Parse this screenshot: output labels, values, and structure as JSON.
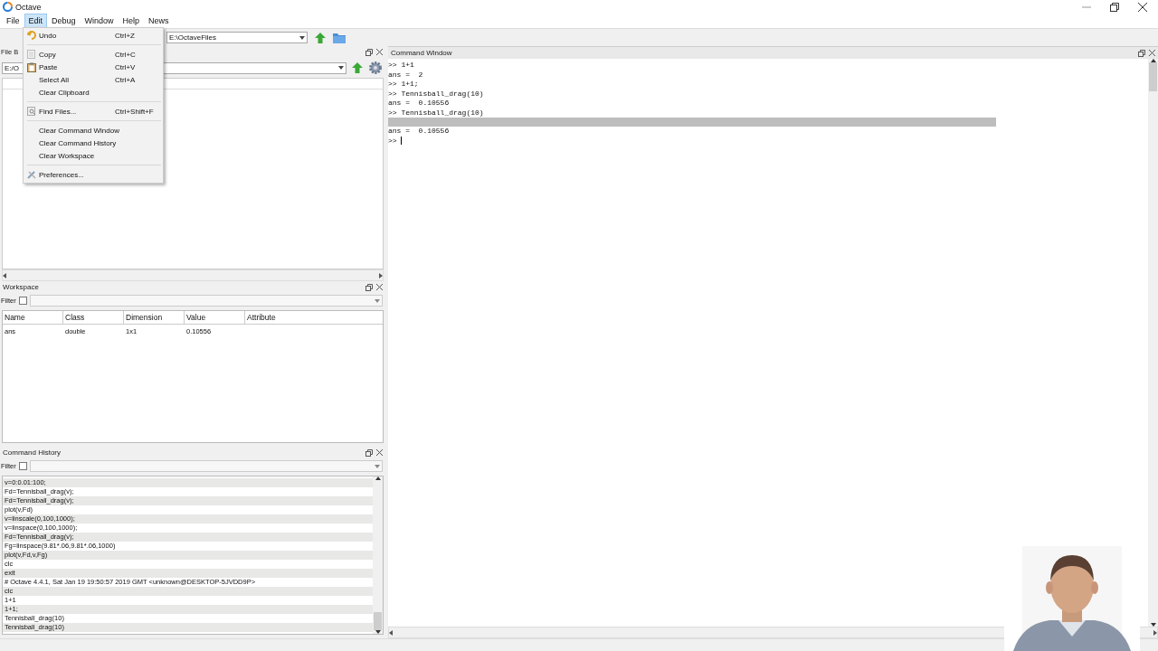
{
  "window": {
    "title": "Octave"
  },
  "menu_bar": [
    {
      "label": "File",
      "selected": false
    },
    {
      "label": "Edit",
      "selected": true
    },
    {
      "label": "Debug",
      "selected": false
    },
    {
      "label": "Window",
      "selected": false
    },
    {
      "label": "Help",
      "selected": false
    },
    {
      "label": "News",
      "selected": false
    }
  ],
  "edit_menu": {
    "groups": [
      [
        {
          "label": "Undo",
          "shortcut": "Ctrl+Z"
        }
      ],
      [
        {
          "label": "Copy",
          "shortcut": "Ctrl+C"
        },
        {
          "label": "Paste",
          "shortcut": "Ctrl+V"
        },
        {
          "label": "Select All",
          "shortcut": "Ctrl+A"
        },
        {
          "label": "Clear Clipboard"
        }
      ],
      [
        {
          "label": "Find Files...",
          "shortcut": "Ctrl+Shift+F"
        }
      ],
      [
        {
          "label": "Clear Command Window"
        },
        {
          "label": "Clear Command History"
        },
        {
          "label": "Clear Workspace"
        }
      ],
      [
        {
          "label": "Preferences..."
        }
      ]
    ]
  },
  "toolbar": {
    "current_directory": "E:\\OctaveFiles"
  },
  "file_browser": {
    "title": "File B",
    "path": "E:/O"
  },
  "workspace": {
    "title": "Workspace",
    "filter": {
      "label": "Filter",
      "checked": false
    },
    "columns": [
      "Name",
      "Class",
      "Dimension",
      "Value",
      "Attribute"
    ],
    "rows": [
      {
        "name": "ans",
        "class": "double",
        "dimension": "1x1",
        "value": "0.10556"
      }
    ]
  },
  "command_history": {
    "title": "Command History",
    "filter": {
      "label": "Filter",
      "checked": false
    },
    "entries": [
      "v=0:0.01:100;",
      "Fd=Tennisball_drag(v);",
      "Fd=Tennisball_drag(v);",
      "plot(v,Fd)",
      "v=linscale(0,100,1000);",
      "v=linspace(0,100,1000);",
      "Fd=Tennisball_drag(v);",
      "Fg=linspace(9.81*.06,9.81*.06,1000)",
      "plot(v,Fd,v,Fg)",
      "clc",
      "exit",
      "# Octave 4.4.1, Sat Jan 19 19:50:57 2019 GMT <unknown@DESKTOP-5JVDD9P>",
      "clc",
      "1+1",
      "1+1;",
      "Tennisball_drag(10)",
      "Tennisball_drag(10)"
    ]
  },
  "command_window": {
    "title": "Command Window",
    "lines": [
      {
        "kind": "text",
        "text": ">> 1+1"
      },
      {
        "kind": "text",
        "text": "ans =  2"
      },
      {
        "kind": "text",
        "text": ">> 1+1;"
      },
      {
        "kind": "text",
        "text": ">> Tennisball_drag(10)"
      },
      {
        "kind": "text",
        "text": "ans =  0.10556"
      },
      {
        "kind": "text",
        "text": ">> Tennisball_drag(10)"
      },
      {
        "kind": "band"
      },
      {
        "kind": "text",
        "text": "ans =  0.10556"
      },
      {
        "kind": "prompt",
        "text": ">>"
      }
    ]
  }
}
